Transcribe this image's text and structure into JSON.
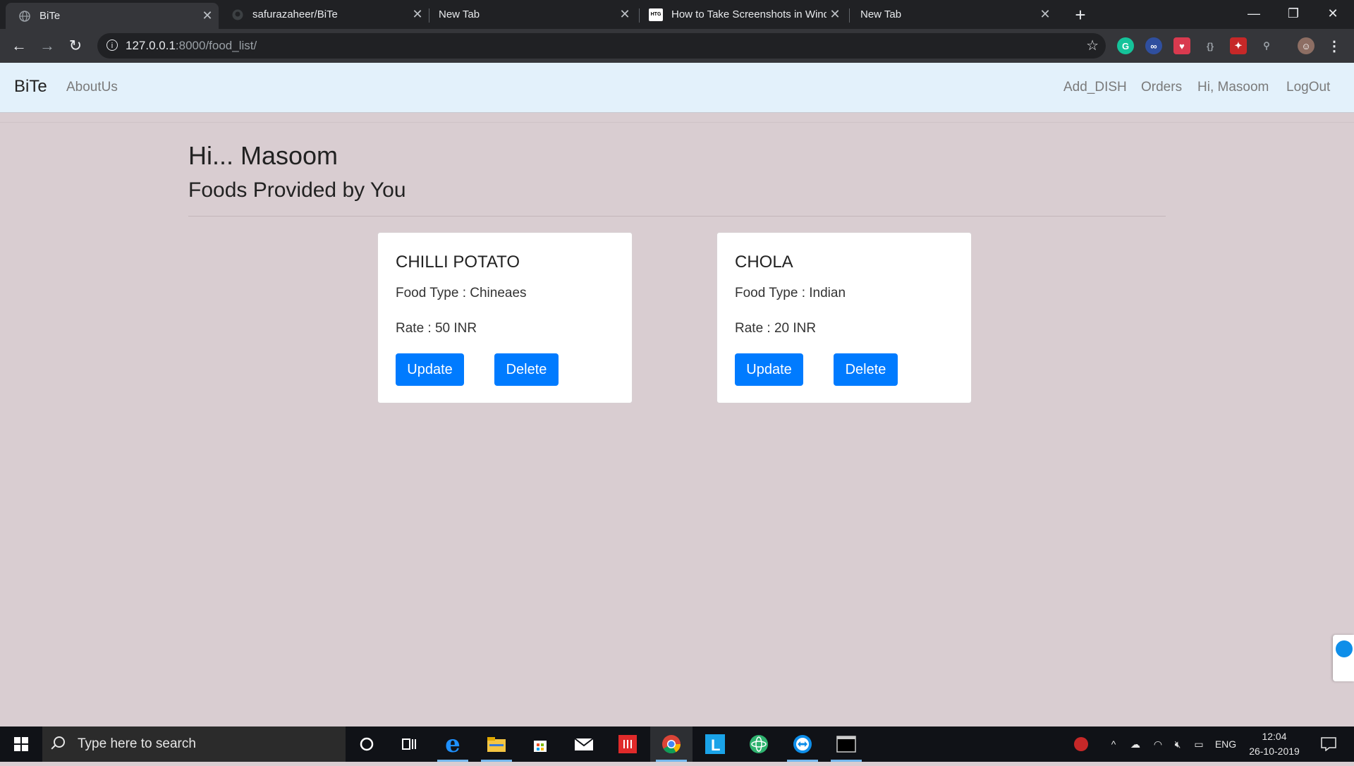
{
  "browser": {
    "tabs": [
      {
        "title": "BiTe",
        "active": true,
        "icon": "globe-icon"
      },
      {
        "title": "safurazaheer/BiTe",
        "active": false,
        "icon": "github-icon"
      },
      {
        "title": "New Tab",
        "active": false,
        "icon": ""
      },
      {
        "title": "How to Take Screenshots in Windo",
        "active": false,
        "icon": "htg-icon",
        "favicon_text": "HTG"
      },
      {
        "title": "New Tab",
        "active": false,
        "icon": ""
      }
    ],
    "url_host": "127.0.0.1",
    "url_path": ":8000/food_list/"
  },
  "navbar": {
    "brand": "BiTe",
    "left_links": [
      "AboutUs"
    ],
    "right_links": [
      "Add_DISH",
      "Orders",
      "Hi, Masoom",
      "LogOut"
    ]
  },
  "page": {
    "greeting": "Hi... Masoom",
    "subheading": "Foods Provided by You"
  },
  "foods": [
    {
      "name": "CHILLI POTATO",
      "type_line": "Food Type : Chineaes",
      "rate_line": "Rate : 50 INR",
      "update_label": "Update",
      "delete_label": "Delete"
    },
    {
      "name": "CHOLA",
      "type_line": "Food Type : Indian",
      "rate_line": "Rate : 20 INR",
      "update_label": "Update",
      "delete_label": "Delete"
    }
  ],
  "taskbar": {
    "search_placeholder": "Type here to search",
    "lang": "ENG",
    "time": "12:04",
    "date": "26-10-2019"
  },
  "colors": {
    "page_bg": "#d9cdd1",
    "navbar_bg": "#e3f1fb",
    "button_primary": "#007bff"
  }
}
